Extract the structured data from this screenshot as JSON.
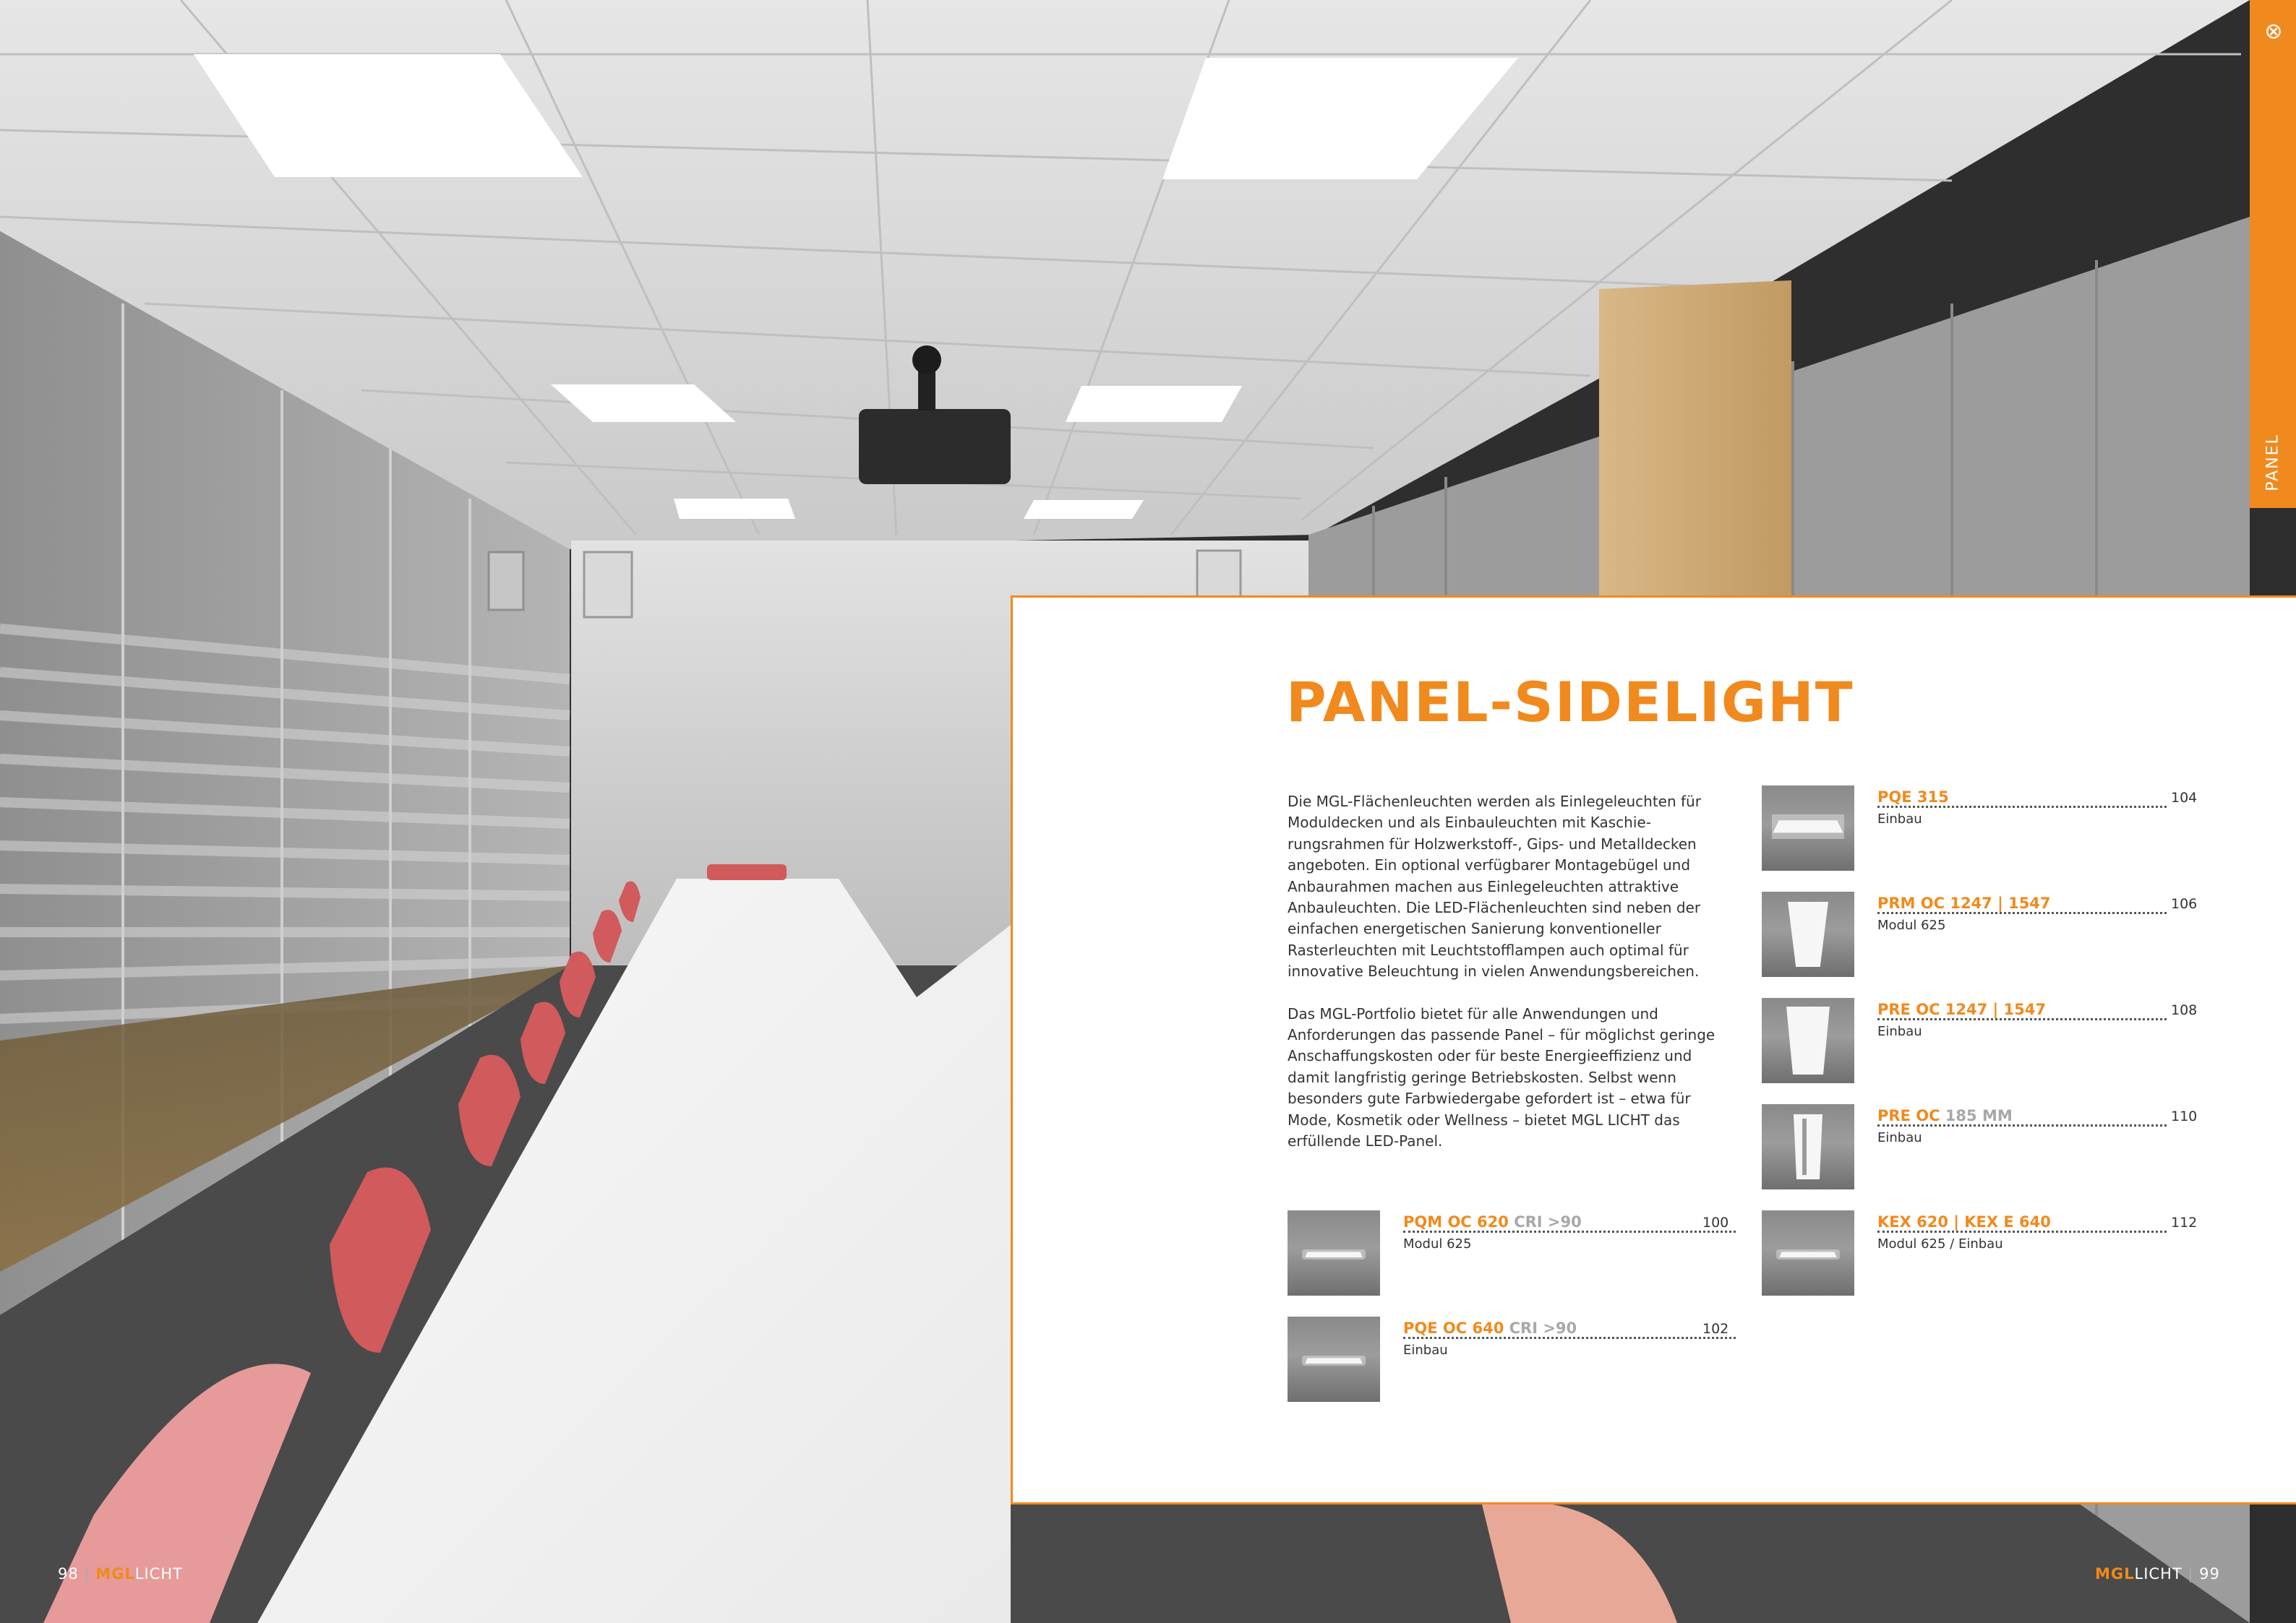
{
  "side_tab": {
    "label": "PANEL",
    "close_icon": "close-circle-icon"
  },
  "content": {
    "title": "PANEL-SIDELIGHT",
    "intro_paragraphs": [
      "Die MGL-Flächenleuchten werden als Einlegeleuchten für Moduldecken und als Einbauleuchten mit Kaschie­rungsrahmen für Holzwerkstoff-, Gips- und Metalldecken angeboten. Ein optional verfügbarer Montagebügel und Anbaurahmen machen aus Einlegeleuchten attraktive Anbauleuchten. Die LED-Flächenleuchten sind neben der einfachen energetischen Sanierung konventioneller Rasterleuchten mit Leuchtstofflampen auch optimal für innovative Beleuchtung in vielen Anwendungsbereichen.",
      "Das MGL-Portfolio bietet für alle Anwendungen und Anforderungen das passende Panel – für möglichst geringe Anschaffungskosten oder für beste Energie­effizienz und damit langfristig geringe Betriebskosten. Selbst wenn besonders gute Farbwiedergabe gefordert ist – etwa für Mode, Kosmetik oder Wellness – bietet MGL LICHT das erfüllende LED-Panel."
    ],
    "products_left": [
      {
        "name": "PQM OC 620",
        "suffix": "CRI >90",
        "sub": "Modul 625",
        "page": "100",
        "icon": "flat-panel-icon"
      },
      {
        "name": "PQE OC 640",
        "suffix": "CRI >90",
        "sub": "Einbau",
        "page": "102",
        "icon": "flat-panel-icon"
      }
    ],
    "products_right": [
      {
        "name": "PQE 315",
        "suffix": "",
        "sub": "Einbau",
        "page": "104",
        "icon": "square-panel-icon"
      },
      {
        "name": "PRM OC 1247 | 1547",
        "suffix": "",
        "sub": "Modul 625",
        "page": "106",
        "icon": "trapezoid-panel-icon"
      },
      {
        "name": "PRE OC 1247 | 1547",
        "suffix": "",
        "sub": "Einbau",
        "page": "108",
        "icon": "trapezoid-panel-icon"
      },
      {
        "name": "PRE OC",
        "suffix": "185 MM",
        "sub": "Einbau",
        "page": "110",
        "icon": "narrow-panel-icon"
      },
      {
        "name": "KEX 620 | KEX E 640",
        "suffix": "",
        "sub": "Modul 625 / Einbau",
        "page": "112",
        "icon": "flat-panel-icon"
      }
    ]
  },
  "footer": {
    "left": {
      "page": "98",
      "brand": "MGL",
      "word": "LICHT"
    },
    "right": {
      "page": "99",
      "brand": "MGL",
      "word": "LICHT"
    }
  },
  "colors": {
    "accent": "#f08a1e",
    "text": "#333333"
  }
}
